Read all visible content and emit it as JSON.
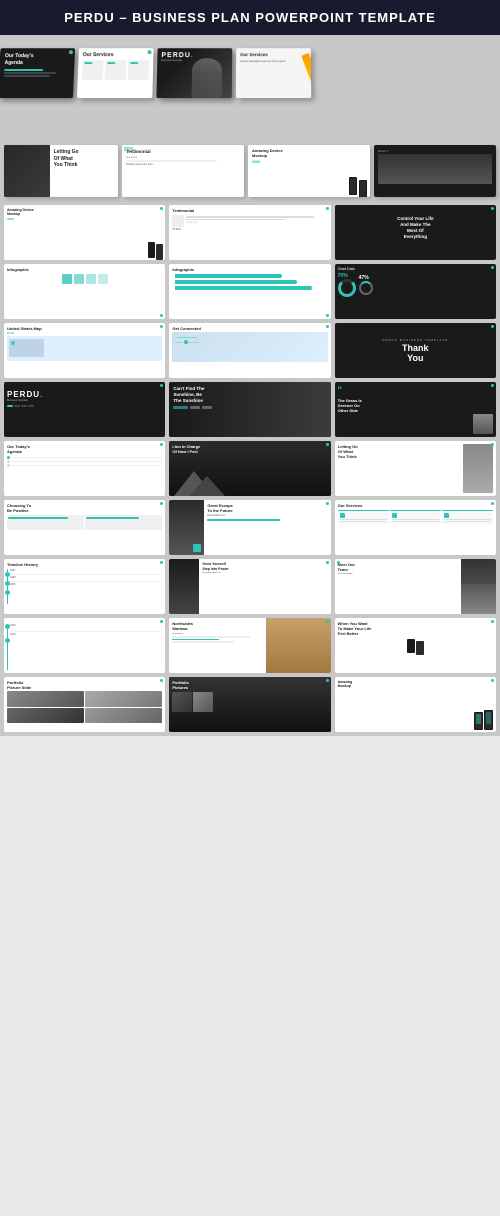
{
  "header": {
    "title": "PERDU – BUSINESS PLAN POWERPOINT TEMPLATE"
  },
  "slides": [
    {
      "id": 1,
      "type": "agenda-dark",
      "title": "Our Today's Agenda"
    },
    {
      "id": 2,
      "type": "services",
      "title": "Our Services"
    },
    {
      "id": 3,
      "type": "hooded-hero",
      "title": "PERDU",
      "subtitle": "Business Template"
    },
    {
      "id": 4,
      "type": "letting-go",
      "title": "Letting Go Of What You Think"
    },
    {
      "id": 5,
      "type": "testimonial",
      "title": "Testimonial"
    },
    {
      "id": 6,
      "type": "device-mockup",
      "title": "Amazing Device Mockup",
      "num": "368K"
    },
    {
      "id": 7,
      "type": "device-mockup-2",
      "title": "Amazing Device Mockup",
      "num": "368K"
    },
    {
      "id": 8,
      "type": "testimonial-2",
      "title": "Testimonial"
    },
    {
      "id": 9,
      "type": "control-life",
      "title": "Control Your Life And Make The Most Of Everything"
    },
    {
      "id": 10,
      "type": "infographic",
      "title": "Infographic"
    },
    {
      "id": 11,
      "type": "infographic-2",
      "title": "Infographic"
    },
    {
      "id": 12,
      "type": "chart-data",
      "title": "Chart Data"
    },
    {
      "id": 13,
      "type": "us-map",
      "title": "United States Map"
    },
    {
      "id": 14,
      "type": "get-connected",
      "title": "Get Connected"
    },
    {
      "id": 15,
      "type": "thank-you",
      "title": "Thank You"
    },
    {
      "id": 16,
      "type": "perdu-dark",
      "title": "PERDU"
    },
    {
      "id": 17,
      "type": "sunshine",
      "title": "Can't Find The Sunshine, Be The Sunshine"
    },
    {
      "id": 18,
      "type": "grass-greener",
      "title": "The Grass Is Greener On Other Side"
    },
    {
      "id": 19,
      "type": "agenda-2",
      "title": "Our Today's Agenda"
    },
    {
      "id": 20,
      "type": "i-am-charge",
      "title": "I Am In Charge Of How I Feel"
    },
    {
      "id": 21,
      "type": "letting-go-2",
      "title": "Letting Go Of What You Think"
    },
    {
      "id": 22,
      "type": "choosing-positive",
      "title": "Choosing To Be Positive"
    },
    {
      "id": 23,
      "type": "great-escape",
      "title": "Great Escape To the Future"
    },
    {
      "id": 24,
      "type": "our-services-2",
      "title": "Our Services"
    },
    {
      "id": 25,
      "type": "timeline",
      "title": "Timeline History"
    },
    {
      "id": 26,
      "type": "grow-yourself",
      "title": "Grow Yourself Step Into Power"
    },
    {
      "id": 27,
      "type": "meet-team",
      "title": "Meet Our Team"
    },
    {
      "id": 28,
      "type": "northuldra",
      "title": "Northuldra Mariana"
    },
    {
      "id": 29,
      "type": "when-you-want",
      "title": "When You Want To Make Your Life Feel Better"
    },
    {
      "id": 30,
      "type": "portfolio-pic",
      "title": "Portfolio Picture Slide"
    },
    {
      "id": 31,
      "type": "portfolio-pics-2",
      "title": "Portfolio Pictures"
    },
    {
      "id": 32,
      "type": "amazing-mockup",
      "title": "Amazing Mockup"
    }
  ],
  "colors": {
    "teal": "#2ec4b6",
    "dark": "#1a1a1a",
    "header_bg": "#1a1a2e"
  }
}
